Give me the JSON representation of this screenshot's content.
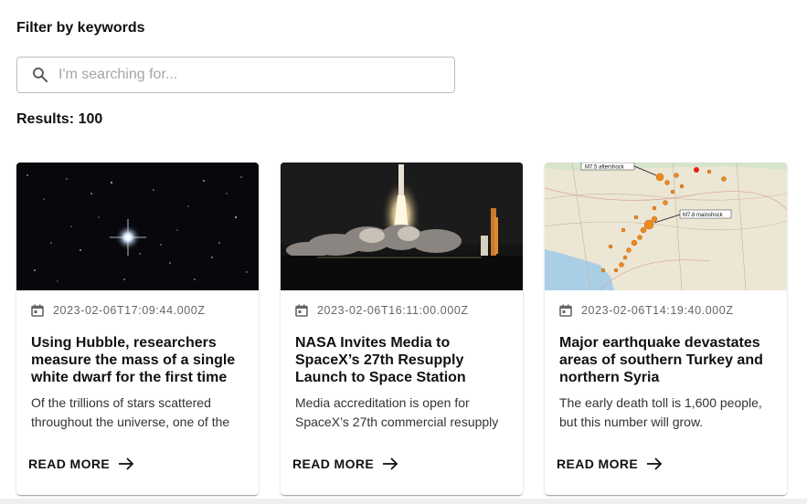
{
  "filter": {
    "title": "Filter by keywords"
  },
  "search": {
    "placeholder": "I'm searching for...",
    "icon": "search-icon"
  },
  "results": {
    "label": "Results: 100"
  },
  "cards": [
    {
      "date": "2023-02-06T17:09:44.000Z",
      "title": "Using Hubble, researchers measure the mass of a single white dwarf for the first time",
      "summary": "Of the trillions of stars scattered throughout the universe, one of the",
      "read_more": "READ MORE",
      "image": "star-field-image"
    },
    {
      "date": "2023-02-06T16:11:00.000Z",
      "title": "NASA Invites Media to SpaceX’s 27th Resupply Launch to Space Station",
      "summary": "Media accreditation is open for SpaceX’s 27th commercial resupply",
      "read_more": "READ MORE",
      "image": "rocket-launch-image"
    },
    {
      "date": "2023-02-06T14:19:40.000Z",
      "title": "Major earthquake devastates areas of southern Turkey and northern Syria",
      "summary": "The early death toll is 1,600 people, but this number will grow.",
      "read_more": "READ MORE",
      "image": "earthquake-map-image",
      "map_labels": [
        "M7.5 aftershock",
        "M7.8 mainshock"
      ]
    }
  ],
  "colors": {
    "text": "#111111",
    "date": "#666666",
    "border": "#bdbdbd"
  }
}
